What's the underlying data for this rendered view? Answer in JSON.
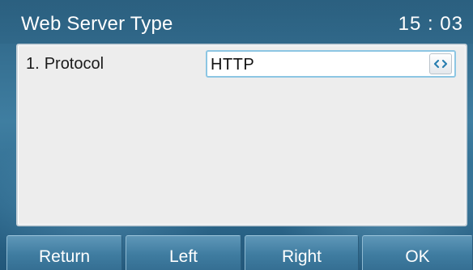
{
  "header": {
    "title": "Web Server Type",
    "clock": "15 : 03"
  },
  "settings": [
    {
      "index": "1.",
      "label": "Protocol",
      "value": "HTTP",
      "control_icon": "left-right-arrows-icon"
    }
  ],
  "soft_keys": [
    {
      "label": "Return"
    },
    {
      "label": "Left"
    },
    {
      "label": "Right"
    },
    {
      "label": "OK"
    }
  ],
  "colors": {
    "background": "#2f6a8d",
    "panel": "#ededed",
    "field_border": "#8cc6e3",
    "spin_arrow": "#2a7fb0",
    "text_light": "#ffffff"
  }
}
